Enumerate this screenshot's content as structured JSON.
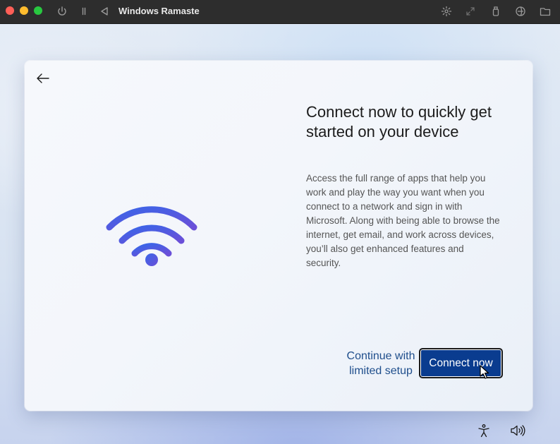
{
  "window": {
    "title": "Windows Ramaste",
    "toolbar_icons": [
      "power-icon",
      "pause-icon",
      "back-triangle-icon",
      "brightness-icon",
      "resize-icon",
      "usb-icon",
      "network-icon",
      "folder-icon"
    ]
  },
  "setup": {
    "heading": "Connect now to quickly get started on your device",
    "description": "Access the full range of apps that help you work and play the way you want when you connect to a network and sign in with Microsoft. Along with being able to browse the internet, get email, and work across devices, you’ll also get enhanced features and security.",
    "limited_label": "Continue with limited setup",
    "connect_label": "Connect now",
    "illustration": "wifi-icon"
  },
  "system_tray": {
    "icons": [
      "accessibility-icon",
      "volume-icon"
    ]
  },
  "colors": {
    "accent": "#0a3c8f",
    "link": "#1f4e8c",
    "wifi_gradient": [
      "#3a66e8",
      "#6a4fd8"
    ]
  }
}
